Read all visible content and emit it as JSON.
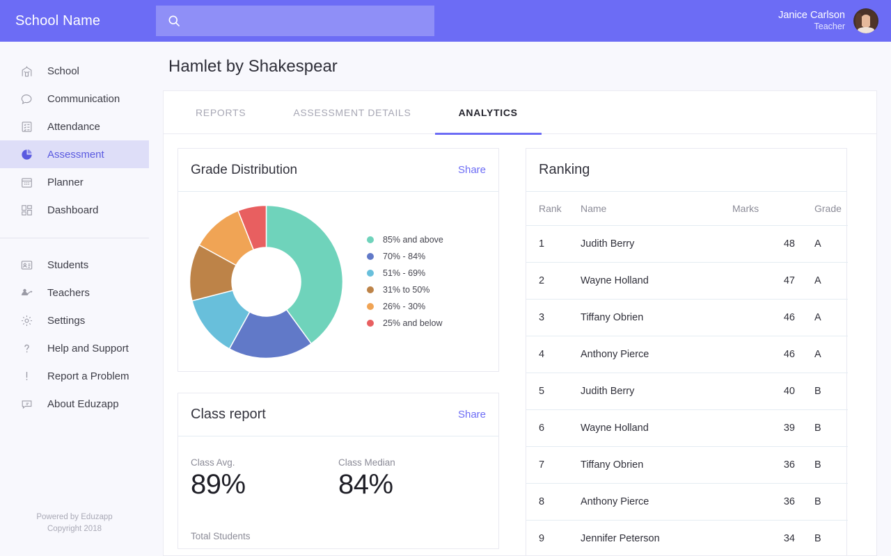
{
  "header": {
    "brand": "School Name",
    "search_value": "",
    "search_placeholder": "",
    "user_name": "Janice Carlson",
    "user_role": "Teacher"
  },
  "sidebar": {
    "primary": [
      {
        "label": "School",
        "icon": "school-icon",
        "active": false
      },
      {
        "label": "Communication",
        "icon": "chat-bubble-icon",
        "active": false
      },
      {
        "label": "Attendance",
        "icon": "checklist-icon",
        "active": false
      },
      {
        "label": "Assessment",
        "icon": "pie-chart-icon",
        "active": true
      },
      {
        "label": "Planner",
        "icon": "calendar-icon",
        "active": false
      },
      {
        "label": "Dashboard",
        "icon": "dashboard-icon",
        "active": false
      }
    ],
    "secondary": [
      {
        "label": "Students",
        "icon": "id-card-icon",
        "active": false
      },
      {
        "label": "Teachers",
        "icon": "teacher-icon",
        "active": false
      },
      {
        "label": "Settings",
        "icon": "gear-icon",
        "active": false
      },
      {
        "label": "Help and Support",
        "icon": "question-mark-icon",
        "active": false
      },
      {
        "label": "Report a Problem",
        "icon": "exclamation-icon",
        "active": false
      },
      {
        "label": "About Eduzapp",
        "icon": "info-bubble-icon",
        "active": false
      }
    ],
    "footer_line1": "Powered by Eduzapp",
    "footer_line2": "Copyright 2018"
  },
  "main": {
    "page_title": "Hamlet by Shakespear",
    "tabs": [
      {
        "label": "REPORTS",
        "active": false
      },
      {
        "label": "ASSESSMENT DETAILS",
        "active": false
      },
      {
        "label": "ANALYTICS",
        "active": true
      }
    ]
  },
  "grade_distribution": {
    "title": "Grade Distribution",
    "share_label": "Share"
  },
  "class_report": {
    "title": "Class report",
    "share_label": "Share",
    "class_avg_label": "Class Avg.",
    "class_avg_value": "89%",
    "class_median_label": "Class Median",
    "class_median_value": "84%",
    "total_students_label": "Total Students"
  },
  "ranking": {
    "title": "Ranking",
    "columns": [
      "Rank",
      "Name",
      "Marks",
      "Grade"
    ],
    "rows": [
      {
        "rank": "1",
        "name": "Judith Berry",
        "marks": "48",
        "grade": "A"
      },
      {
        "rank": "2",
        "name": "Wayne Holland",
        "marks": "47",
        "grade": "A"
      },
      {
        "rank": "3",
        "name": "Tiffany Obrien",
        "marks": "46",
        "grade": "A"
      },
      {
        "rank": "4",
        "name": "Anthony Pierce",
        "marks": "46",
        "grade": "A"
      },
      {
        "rank": "5",
        "name": "Judith Berry",
        "marks": "40",
        "grade": "B"
      },
      {
        "rank": "6",
        "name": "Wayne Holland",
        "marks": "39",
        "grade": "B"
      },
      {
        "rank": "7",
        "name": "Tiffany Obrien",
        "marks": "36",
        "grade": "B"
      },
      {
        "rank": "8",
        "name": "Anthony Pierce",
        "marks": "36",
        "grade": "B"
      },
      {
        "rank": "9",
        "name": "Jennifer Peterson",
        "marks": "34",
        "grade": "B"
      }
    ]
  },
  "chart_data": {
    "type": "pie",
    "title": "Grade Distribution",
    "donut": true,
    "inner_radius_ratio": 0.45,
    "start_angle_deg": 0,
    "direction": "clockwise",
    "legend_position": "right",
    "categories": [
      "85% and above",
      "70% - 84%",
      "51% - 69%",
      "31% to 50%",
      "26% - 30%",
      "25% and below"
    ],
    "values": [
      40,
      18,
      13,
      12,
      11,
      6
    ],
    "colors": [
      "#6fd3bb",
      "#6179c8",
      "#68bfdb",
      "#bd8348",
      "#f0a455",
      "#e85f60"
    ]
  },
  "colors": {
    "brand": "#6c6cf5",
    "accent": "#5a5ae0",
    "sidebar_bg": "#f8f8fd",
    "page_bg": "#f8f8fd"
  }
}
